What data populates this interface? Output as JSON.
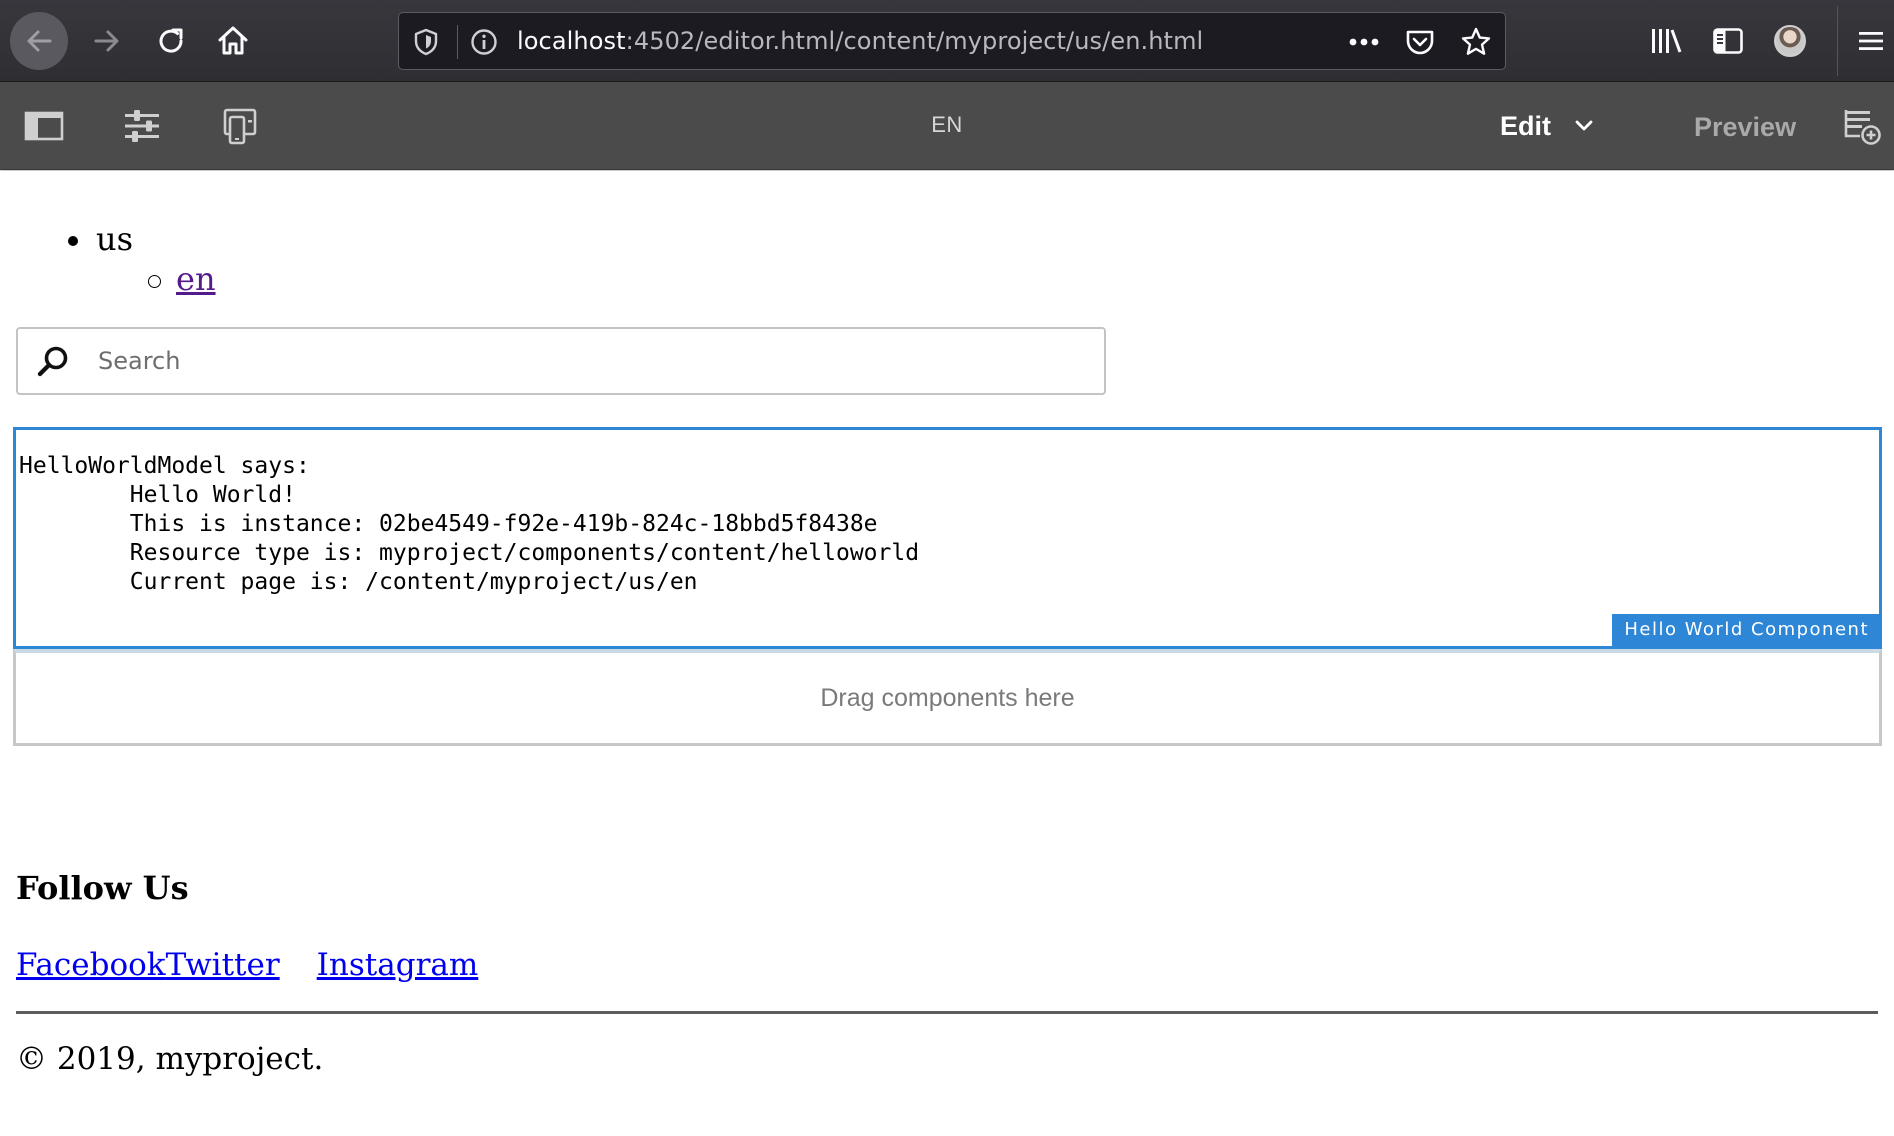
{
  "browser": {
    "url_host": "localhost",
    "url_rest": ":4502/editor.html/content/myproject/us/en.html",
    "icons": {
      "back": "arrow-left-icon",
      "forward": "arrow-right-icon",
      "reload": "reload-icon",
      "home": "home-icon",
      "tracking": "shield-icon",
      "site_info": "info-icon",
      "page_actions": "more-horizontal-icon",
      "pocket": "pocket-icon",
      "bookmark": "star-icon",
      "library": "library-icon",
      "sidebar": "sidebar-icon",
      "account": "avatar-icon",
      "menu": "hamburger-menu-icon"
    }
  },
  "editor": {
    "title": "EN",
    "mode_label": "Edit",
    "preview_label": "Preview",
    "icons": {
      "side_panel": "side-panel-icon",
      "page_properties": "sliders-icon",
      "emulator": "devices-icon",
      "mode_dropdown": "chevron-down-icon",
      "annotations": "annotate-icon"
    }
  },
  "page": {
    "nav": {
      "top_item": "us",
      "sub_item": "en"
    },
    "search": {
      "placeholder": "Search",
      "value": ""
    },
    "hello_world": {
      "text": "HelloWorldModel says:\n        Hello World!\n        This is instance: 02be4549-f92e-419b-824c-18bbd5f8438e\n        Resource type is: myproject/components/content/helloworld\n        Current page is: /content/myproject/us/en",
      "badge": "Hello World Component"
    },
    "drop_zone": "Drag components here",
    "footer": {
      "follow_title": "Follow Us",
      "links": [
        "Facebook",
        "Twitter",
        "Instagram"
      ],
      "copyright": "© 2019, myproject."
    }
  },
  "colors": {
    "browser_bg": "#2f2e33",
    "editor_bar_bg": "#4b4b4b",
    "component_accent": "#2d86d6",
    "visited_link": "#551a8b",
    "link": "#0000ee"
  }
}
